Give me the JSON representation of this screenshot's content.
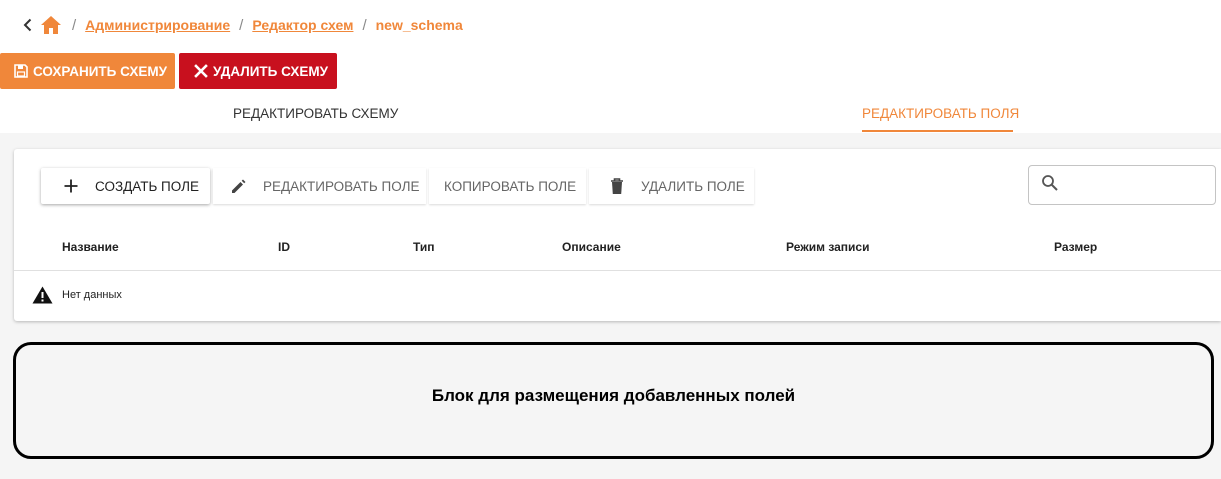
{
  "breadcrumb": {
    "items": [
      "Администрирование",
      "Редактор схем"
    ],
    "current": "new_schema",
    "separator": "/"
  },
  "actions": {
    "save_label": "СОХРАНИТЬ СХЕМУ",
    "delete_label": "УДАЛИТЬ СХЕМУ"
  },
  "tabs": [
    {
      "label": "РЕДАКТИРОВАТЬ СХЕМУ",
      "active": false
    },
    {
      "label": "РЕДАКТИРОВАТЬ ПОЛЯ",
      "active": true
    }
  ],
  "toolbar": {
    "create_label": "СОЗДАТЬ ПОЛЕ",
    "edit_label": "РЕДАКТИРОВАТЬ ПОЛЕ",
    "copy_label": "КОПИРОВАТЬ ПОЛЕ",
    "delete_label": "УДАЛИТЬ ПОЛЕ"
  },
  "search": {
    "placeholder": "",
    "value": ""
  },
  "table": {
    "columns": [
      "Название",
      "ID",
      "Тип",
      "Описание",
      "Режим записи",
      "Размер"
    ],
    "empty_text": "Нет данных"
  },
  "drop_zone": {
    "label": "Блок для размещения добавленных полей"
  },
  "colors": {
    "accent": "#f0873a",
    "danger": "#c8101e",
    "background": "#f5f5f5"
  },
  "icons": {
    "back": "chevron-left-icon",
    "home": "home-icon",
    "save": "floppy-icon",
    "delete": "close-icon",
    "create": "plus-icon",
    "edit": "pencil-icon",
    "trash": "trash-icon",
    "search": "search-icon",
    "warning": "warning-icon"
  }
}
